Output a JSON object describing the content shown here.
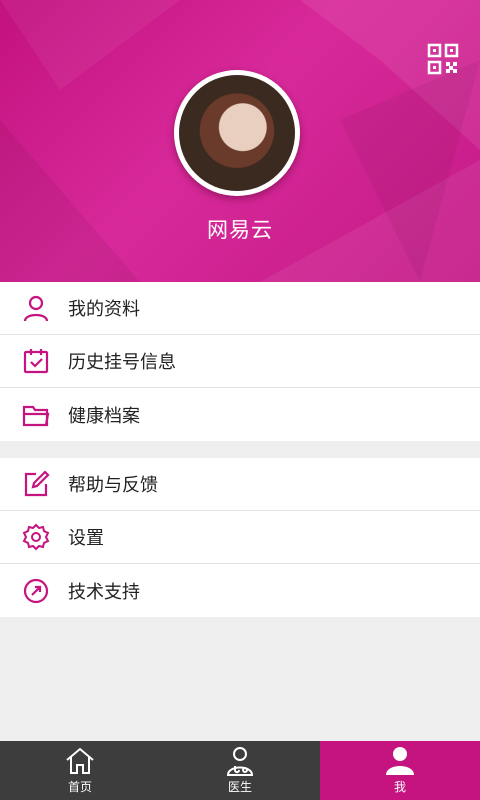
{
  "profile": {
    "username": "网易云"
  },
  "menu": {
    "group1": [
      {
        "label": "我的资料",
        "icon": "user-icon"
      },
      {
        "label": "历史挂号信息",
        "icon": "calendar-check-icon"
      },
      {
        "label": "健康档案",
        "icon": "folder-icon"
      }
    ],
    "group2": [
      {
        "label": "帮助与反馈",
        "icon": "edit-icon"
      },
      {
        "label": "设置",
        "icon": "gear-icon"
      },
      {
        "label": "技术支持",
        "icon": "compass-icon"
      }
    ]
  },
  "tabs": [
    {
      "label": "首页",
      "icon": "home-icon"
    },
    {
      "label": "医生",
      "icon": "doctor-icon"
    },
    {
      "label": "我",
      "icon": "person-icon"
    }
  ],
  "colors": {
    "brand": "#c5137f",
    "tabbar_bg": "#3d3d3d",
    "icon": "#c5137f"
  }
}
